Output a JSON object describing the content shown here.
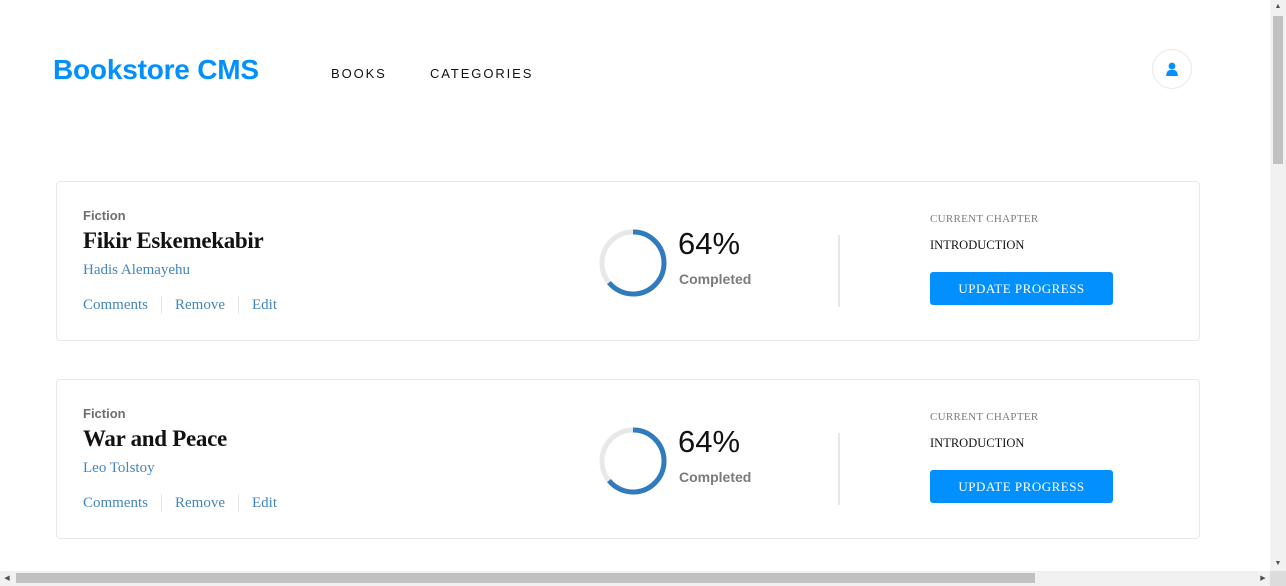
{
  "header": {
    "logo": "Bookstore CMS",
    "nav": [
      {
        "label": "BOOKS"
      },
      {
        "label": "CATEGORIES"
      }
    ],
    "user_icon": "user-icon"
  },
  "books": [
    {
      "genre": "Fiction",
      "title": "Fikir Eskemekabir",
      "author": "Hadis Alemayehu",
      "actions": [
        "Comments",
        "Remove",
        "Edit"
      ],
      "progress": 64,
      "percent_label": "64%",
      "completed_label": "Completed",
      "chapter_label": "CURRENT CHAPTER",
      "chapter": "INTRODUCTION",
      "update_label": "UPDATE PROGRESS"
    },
    {
      "genre": "Fiction",
      "title": "War and Peace",
      "author": "Leo Tolstoy",
      "actions": [
        "Comments",
        "Remove",
        "Edit"
      ],
      "progress": 64,
      "percent_label": "64%",
      "completed_label": "Completed",
      "chapter_label": "CURRENT CHAPTER",
      "chapter": "INTRODUCTION",
      "update_label": "UPDATE PROGRESS"
    }
  ],
  "colors": {
    "accent": "#0290ff",
    "link": "#4386bf",
    "ring_track": "#e8e8e8",
    "ring_fill": "#307bbe"
  }
}
